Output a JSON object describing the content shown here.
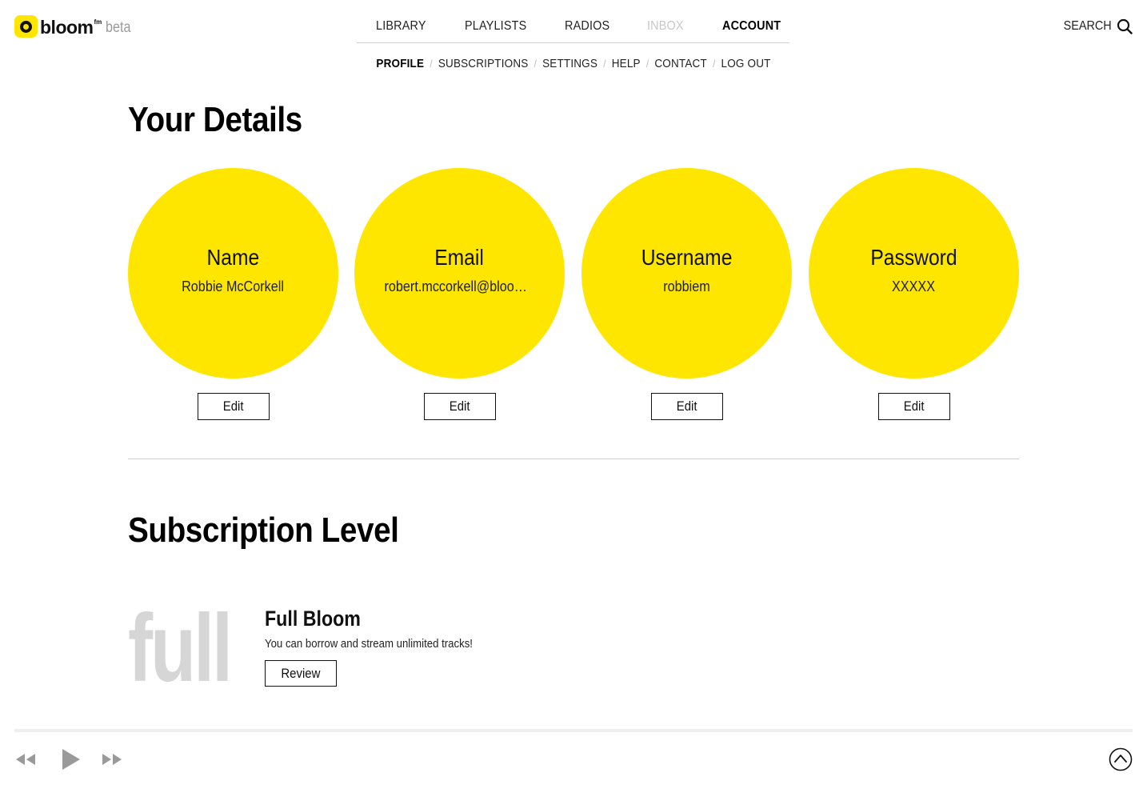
{
  "brand": {
    "name": "bloom",
    "superscript": "fm",
    "tag": "beta",
    "accent": "#ffe600"
  },
  "nav": {
    "items": [
      {
        "label": "LIBRARY",
        "state": "normal"
      },
      {
        "label": "PLAYLISTS",
        "state": "normal"
      },
      {
        "label": "RADIOS",
        "state": "normal"
      },
      {
        "label": "INBOX",
        "state": "disabled"
      },
      {
        "label": "ACCOUNT",
        "state": "active"
      }
    ],
    "search_label": "SEARCH"
  },
  "subnav": {
    "items": [
      {
        "label": "PROFILE",
        "state": "active"
      },
      {
        "label": "SUBSCRIPTIONS",
        "state": "normal"
      },
      {
        "label": "SETTINGS",
        "state": "normal"
      },
      {
        "label": "HELP",
        "state": "normal"
      },
      {
        "label": "CONTACT",
        "state": "normal"
      },
      {
        "label": "LOG OUT",
        "state": "normal"
      }
    ],
    "separator": "/"
  },
  "details": {
    "title": "Your Details",
    "fields": [
      {
        "label": "Name",
        "value": "Robbie McCorkell",
        "action": "Edit"
      },
      {
        "label": "Email",
        "value": "robert.mccorkell@bloom.fm",
        "action": "Edit"
      },
      {
        "label": "Username",
        "value": "robbiem",
        "action": "Edit"
      },
      {
        "label": "Password",
        "value": "XXXXX",
        "action": "Edit"
      }
    ]
  },
  "subscription": {
    "title": "Subscription Level",
    "level_badge": "full",
    "plan_name": "Full Bloom",
    "description": "You can borrow and stream unlimited tracks!",
    "action": "Review"
  },
  "player": {
    "controls": [
      "rewind-icon",
      "play-icon",
      "fast-forward-icon"
    ],
    "expand_icon": "chevron-up-circle-icon"
  }
}
